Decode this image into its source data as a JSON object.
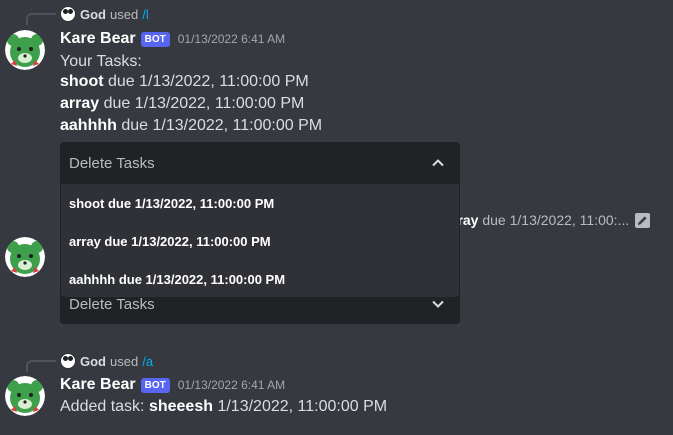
{
  "messages": [
    {
      "reply": {
        "user": "God",
        "used": "used",
        "command": "/l"
      },
      "author": "Kare Bear",
      "bot_tag": "BOT",
      "timestamp": "01/13/2022 6:41 AM",
      "heading": "Your Tasks:",
      "tasks": [
        {
          "name": "shoot",
          "due": "due 1/13/2022, 11:00:00 PM"
        },
        {
          "name": "array",
          "due": "due 1/13/2022, 11:00:00 PM"
        },
        {
          "name": "aahhhh",
          "due": "due 1/13/2022, 11:00:00 PM"
        }
      ],
      "select": {
        "placeholder": "Delete Tasks",
        "expanded": true,
        "options": [
          "shoot due 1/13/2022, 11:00:00 PM",
          "array due 1/13/2022, 11:00:00 PM",
          "aahhhh due 1/13/2022, 11:00:00 PM"
        ]
      }
    },
    {
      "peek": {
        "name": "rray",
        "rest": "due 1/13/2022, 11:00:..."
      },
      "select": {
        "placeholder": "Delete Tasks",
        "expanded": false
      }
    },
    {
      "reply": {
        "user": "God",
        "used": "used",
        "command": "/a"
      },
      "author": "Kare Bear",
      "bot_tag": "BOT",
      "timestamp": "01/13/2022 6:41 AM",
      "content": {
        "prefix": "Added task:",
        "task": "sheeesh",
        "date": "1/13/2022, 11:00:00 PM"
      }
    }
  ],
  "icons": {
    "avatar": "kare-bear-avatar",
    "mini_avatar": "panda-avatar",
    "chevron_up": "chevron-up-icon",
    "chevron_down": "chevron-down-icon",
    "edit": "edit-icon"
  },
  "colors": {
    "background": "#36393f",
    "blurple": "#5865f2",
    "link": "#00aff4",
    "avatar_green": "#3fa04b"
  }
}
